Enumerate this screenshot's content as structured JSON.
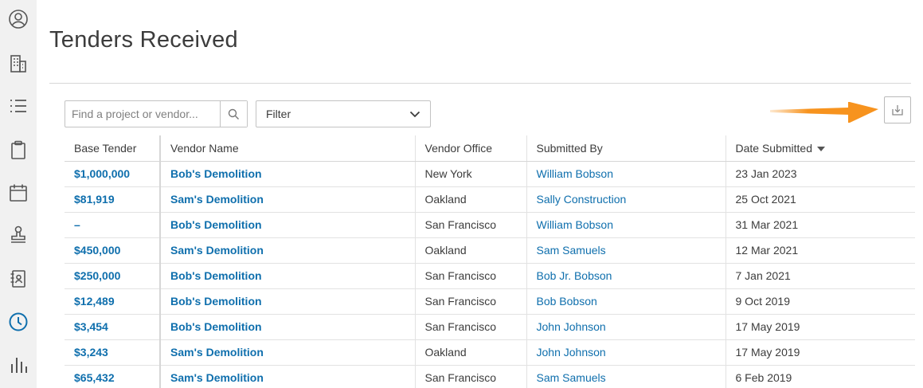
{
  "sidebar": {
    "items": [
      {
        "icon": "user-circle-icon"
      },
      {
        "icon": "building-icon"
      },
      {
        "icon": "list-icon"
      },
      {
        "icon": "clipboard-icon"
      },
      {
        "icon": "calendar-icon"
      },
      {
        "icon": "stamp-icon"
      },
      {
        "icon": "address-book-icon"
      },
      {
        "icon": "clock-icon",
        "active": true
      },
      {
        "icon": "bar-chart-icon"
      }
    ],
    "active_color": "#0f6fad"
  },
  "page": {
    "title": "Tenders Received"
  },
  "search": {
    "placeholder": "Find a project or vendor...",
    "value": ""
  },
  "filter": {
    "label": "Filter"
  },
  "export": {
    "icon": "download-icon"
  },
  "table": {
    "columns": [
      "Base Tender",
      "Vendor Name",
      "Vendor Office",
      "Submitted By",
      "Date Submitted"
    ],
    "sort_column": "Date Submitted",
    "rows": [
      {
        "base": "$1,000,000",
        "vendor": "Bob's Demolition",
        "office": "New York",
        "by": "William Bobson",
        "date": "23 Jan 2023"
      },
      {
        "base": "$81,919",
        "vendor": "Sam's Demolition",
        "office": "Oakland",
        "by": "Sally Construction",
        "date": "25 Oct 2021"
      },
      {
        "base": "–",
        "vendor": "Bob's Demolition",
        "office": "San Francisco",
        "by": "William Bobson",
        "date": "31 Mar 2021"
      },
      {
        "base": "$450,000",
        "vendor": "Sam's Demolition",
        "office": "Oakland",
        "by": "Sam Samuels",
        "date": "12 Mar 2021"
      },
      {
        "base": "$250,000",
        "vendor": "Bob's Demolition",
        "office": "San Francisco",
        "by": "Bob Jr. Bobson",
        "date": "7 Jan 2021"
      },
      {
        "base": "$12,489",
        "vendor": "Bob's Demolition",
        "office": "San Francisco",
        "by": "Bob Bobson",
        "date": "9 Oct 2019"
      },
      {
        "base": "$3,454",
        "vendor": "Bob's Demolition",
        "office": "San Francisco",
        "by": "John Johnson",
        "date": "17 May 2019"
      },
      {
        "base": "$3,243",
        "vendor": "Sam's Demolition",
        "office": "Oakland",
        "by": "John Johnson",
        "date": "17 May 2019"
      },
      {
        "base": "$65,432",
        "vendor": "Sam's Demolition",
        "office": "San Francisco",
        "by": "Sam Samuels",
        "date": "6 Feb 2019"
      }
    ]
  },
  "annotation": {
    "arrow_color": "#f7931e"
  }
}
